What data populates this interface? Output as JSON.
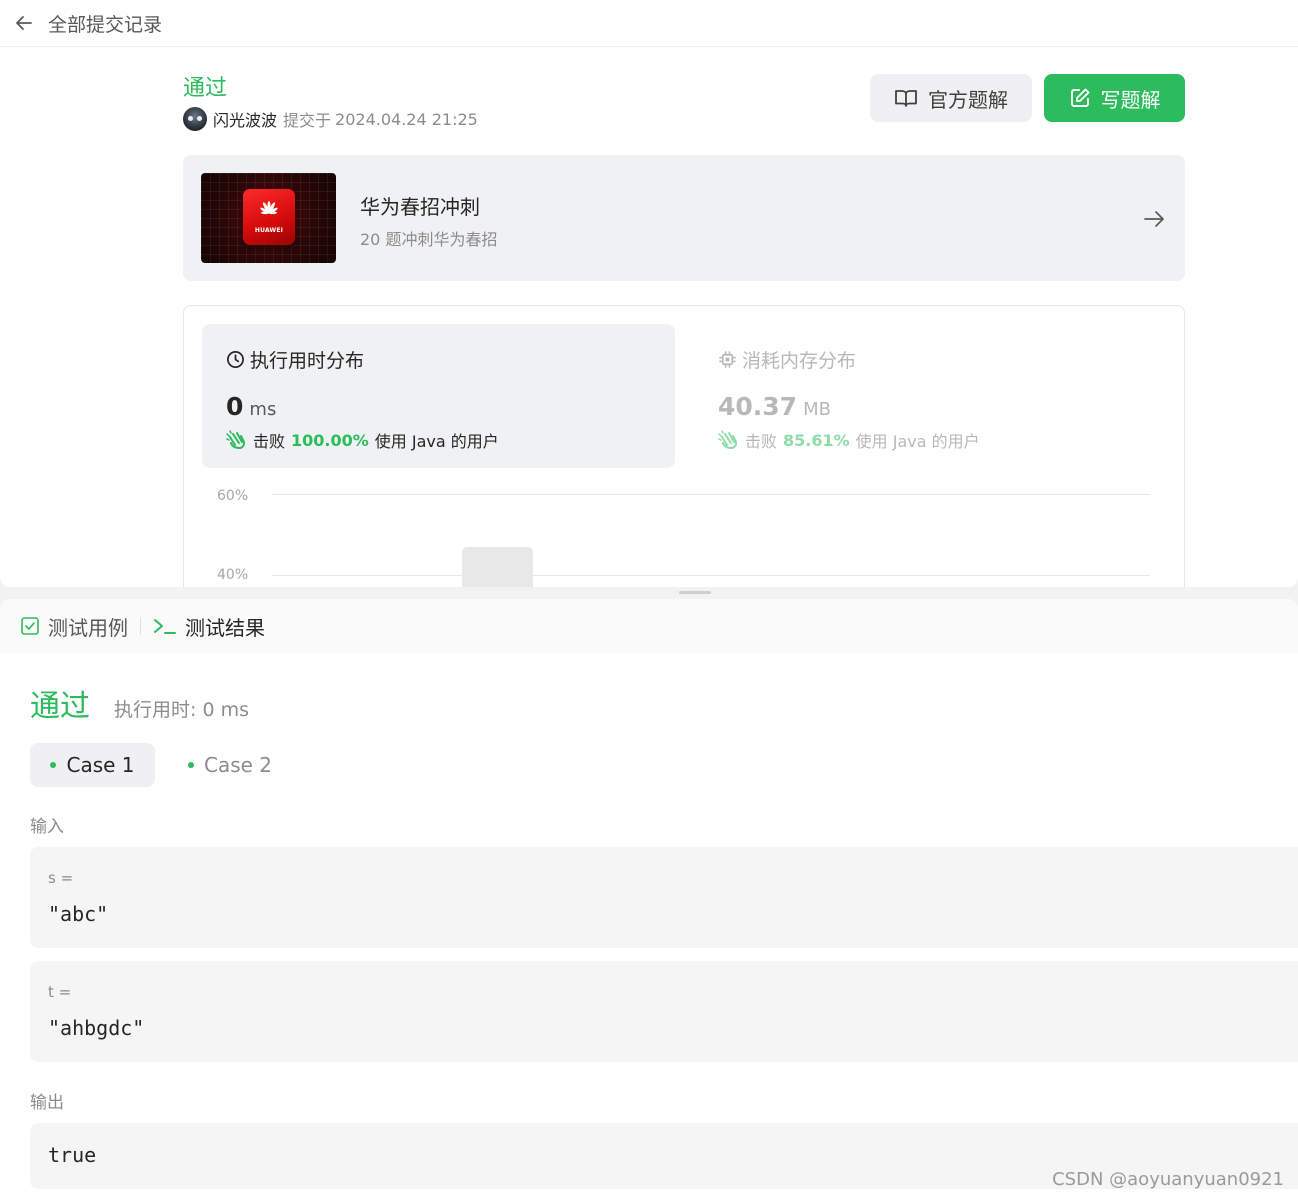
{
  "topbar": {
    "title": "全部提交记录"
  },
  "submission": {
    "status": "通过",
    "submitter": "闪光波波",
    "submit_prefix": "提交于",
    "submit_time": "2024.04.24 21:25"
  },
  "buttons": {
    "official_solution": "官方题解",
    "write_solution": "写题解"
  },
  "study_plan": {
    "title": "华为春招冲刺",
    "subtitle": "20 题冲刺华为春招",
    "logo_text": "HUAWEI"
  },
  "performance": {
    "runtime": {
      "title": "执行用时分布",
      "value": "0",
      "unit": "ms",
      "beat_label": "击败",
      "beat_pct": "100.00%",
      "beat_rest": "使用 Java 的用户"
    },
    "memory": {
      "title": "消耗内存分布",
      "value": "40.37",
      "unit": "MB",
      "beat_label": "击败",
      "beat_pct": "85.61%",
      "beat_rest": "使用 Java 的用户"
    }
  },
  "chart_data": {
    "type": "bar",
    "yticks": [
      "60%",
      "40%"
    ],
    "visible_bar_top_pct": 47
  },
  "console": {
    "tabs": [
      {
        "label": "测试用例"
      },
      {
        "label": "测试结果"
      }
    ],
    "status": "通过",
    "runtime": "执行用时: 0 ms",
    "cases": [
      {
        "label": "Case 1"
      },
      {
        "label": "Case 2"
      }
    ],
    "input_label": "输入",
    "inputs": [
      {
        "name": "s =",
        "value": "\"abc\""
      },
      {
        "name": "t =",
        "value": "\"ahbgdc\""
      }
    ],
    "output_label": "输出",
    "output_value": "true"
  },
  "watermark": "CSDN @aoyuanyuan0921",
  "colors": {
    "accent": "#2cbb5d",
    "muted_accent": "#8fdca8",
    "text": "#262626"
  }
}
